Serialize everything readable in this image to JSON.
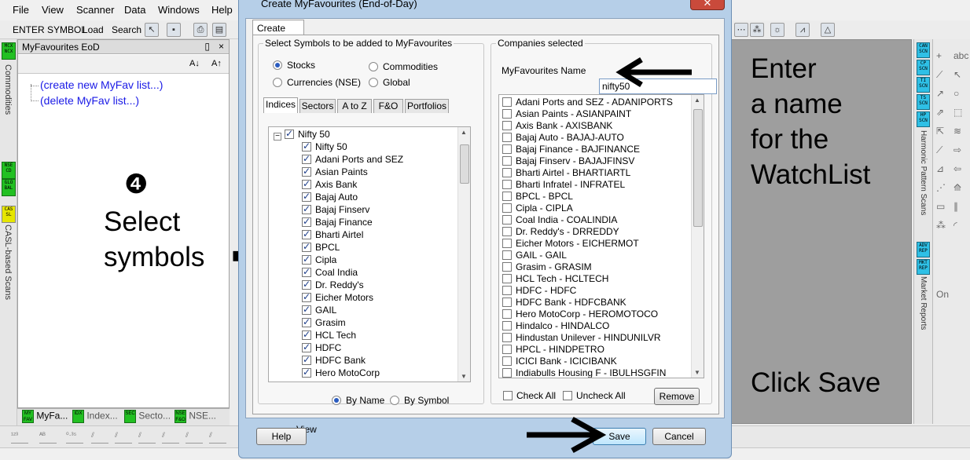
{
  "menu": [
    "File",
    "View",
    "Scanner",
    "Data",
    "Windows",
    "Help"
  ],
  "toolbar": {
    "enter_symbol": "ENTER SYMBOL",
    "load": "Load",
    "search": "Search"
  },
  "left_strip": {
    "badge1": "MCX NCX",
    "label1": "Commodities",
    "badge2": "NSE CD",
    "badge3": "GLO BAL",
    "badge4": "CAS SL",
    "label2": "CASL-based Scans"
  },
  "fav_panel": {
    "title": "MyFavourites EoD",
    "pin": "▯",
    "close": "×",
    "sort_asc": "A↓",
    "sort_desc": "A↑",
    "links": [
      "(create new MyFav list...)",
      "(delete MyFav list...)"
    ]
  },
  "bottom_tabs": [
    {
      "badge": "MY FAV",
      "label": "MyFa..."
    },
    {
      "badge": "IDX",
      "label": "Index..."
    },
    {
      "badge": "SEC",
      "label": "Secto..."
    },
    {
      "badge": "NSE F&O",
      "label": "NSE..."
    }
  ],
  "annotations": {
    "step_number": "❹",
    "select_line1": "Select",
    "select_line2": "symbols",
    "brace": "{",
    "enter_name": [
      "Enter",
      "a name",
      "for the",
      "WatchList"
    ],
    "click_save": "Click Save",
    "arrow": "⟵",
    "arrow_right": "⟶"
  },
  "dialog": {
    "title": "Create MyFavourites (End-of-Day)",
    "close": "✕",
    "tab": "Create New",
    "left_group": "Select Symbols to be added to MyFavourites",
    "radios": [
      {
        "label": "Stocks",
        "selected": true
      },
      {
        "label": "Commodities",
        "selected": false
      },
      {
        "label": "Currencies (NSE)",
        "selected": false
      },
      {
        "label": "Global",
        "selected": false
      }
    ],
    "subtabs": [
      "Indices",
      "Sectors",
      "A to Z",
      "F&O",
      "Portfolios"
    ],
    "tree_root": "Nifty 50",
    "tree_toggle": "−",
    "symbols": [
      "Nifty 50",
      "Adani Ports and SEZ",
      "Asian Paints",
      "Axis Bank",
      "Bajaj Auto",
      "Bajaj Finserv",
      "Bajaj Finance",
      "Bharti Airtel",
      "BPCL",
      "Cipla",
      "Coal India",
      "Dr. Reddy's",
      "Eicher Motors",
      "GAIL",
      "Grasim",
      "HCL Tech",
      "HDFC",
      "HDFC Bank",
      "Hero MotoCorp"
    ],
    "view_label": "View",
    "view_options": [
      {
        "label": "By Name",
        "selected": true
      },
      {
        "label": "By Symbol",
        "selected": false
      }
    ],
    "right_group": "Companies selected",
    "name_label": "MyFavourites Name",
    "name_value": "nifty50",
    "companies": [
      "Adani Ports and SEZ - ADANIPORTS",
      "Asian Paints - ASIANPAINT",
      "Axis Bank - AXISBANK",
      "Bajaj Auto - BAJAJ-AUTO",
      "Bajaj Finance - BAJFINANCE",
      "Bajaj Finserv - BAJAJFINSV",
      "Bharti Airtel - BHARTIARTL",
      "Bharti Infratel - INFRATEL",
      "BPCL - BPCL",
      "Cipla - CIPLA",
      "Coal India - COALINDIA",
      "Dr. Reddy's - DRREDDY",
      "Eicher Motors - EICHERMOT",
      "GAIL - GAIL",
      "Grasim - GRASIM",
      "HCL Tech - HCLTECH",
      "HDFC - HDFC",
      "HDFC Bank - HDFCBANK",
      "Hero MotoCorp - HEROMOTOCO",
      "Hindalco - HINDALCO",
      "Hindustan Unilever - HINDUNILVR",
      "HPCL - HINDPETRO",
      "ICICI Bank - ICICIBANK",
      "Indiabulls Housing F - IBULHSGFIN"
    ],
    "check_all": "Check All",
    "uncheck_all": "Uncheck All",
    "remove": "Remove",
    "help": "Help",
    "save": "Save",
    "cancel": "Cancel"
  },
  "right_strip": {
    "badges": [
      "CAN SCN",
      "CP SCN",
      "TI SCN",
      "TS SCN",
      "HP SCN"
    ],
    "label1": "Harmonic Pattern Scans",
    "badges2": [
      "ADV REP",
      "MKT REP"
    ],
    "label2": "Market Reports"
  },
  "draw_tools": [
    "abc",
    "⬚",
    "○",
    "↗",
    "⇗",
    "⇱",
    "⟋",
    "⊿",
    "≋",
    "⋰",
    "⟰",
    "⬚",
    "⇨",
    "⇦",
    "▭",
    "∥",
    "⁂",
    "◜",
    "On"
  ]
}
